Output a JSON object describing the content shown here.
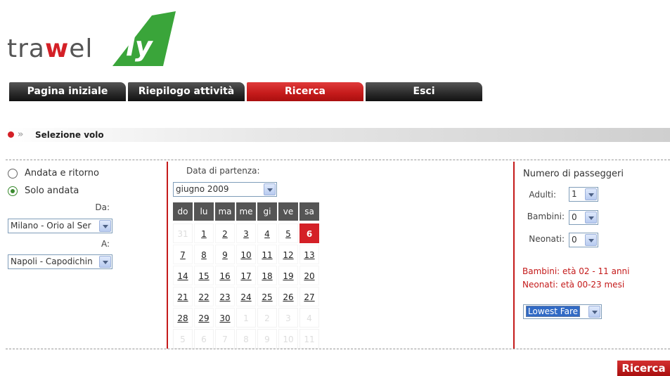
{
  "brand": {
    "part1": "tra",
    "part2": "w",
    "part3": "el",
    "fly": "fly",
    "accent": "#d42027",
    "logo_green": "#3aa53a"
  },
  "tabs": [
    {
      "label": "Pagina iniziale",
      "active": false
    },
    {
      "label": "Riepilogo attività",
      "active": false
    },
    {
      "label": "Ricerca",
      "active": true
    },
    {
      "label": "Esci",
      "active": false
    }
  ],
  "section": {
    "title": "Selezione volo"
  },
  "trip": {
    "options": [
      {
        "label": "Andata e ritorno",
        "checked": false
      },
      {
        "label": "Solo andata",
        "checked": true
      }
    ],
    "from_label": "Da:",
    "from_value": "Milano - Orio al Ser",
    "to_label": "A:",
    "to_value": "Napoli - Capodichin"
  },
  "calendar": {
    "label": "Data di partenza:",
    "month": "giugno 2009",
    "days": [
      "do",
      "lu",
      "ma",
      "me",
      "gi",
      "ve",
      "sa"
    ],
    "weeks": [
      [
        "31",
        "1",
        "2",
        "3",
        "4",
        "5",
        "6"
      ],
      [
        "7",
        "8",
        "9",
        "10",
        "11",
        "12",
        "13"
      ],
      [
        "14",
        "15",
        "16",
        "17",
        "18",
        "19",
        "20"
      ],
      [
        "21",
        "22",
        "23",
        "24",
        "25",
        "26",
        "27"
      ],
      [
        "28",
        "29",
        "30",
        "1",
        "2",
        "3",
        "4"
      ],
      [
        "5",
        "6",
        "7",
        "8",
        "9",
        "10",
        "11"
      ]
    ],
    "selected": "6"
  },
  "passengers": {
    "title": "Numero di passeggeri",
    "adults_label": "Adulti:",
    "adults_value": "1",
    "children_label": "Bambini:",
    "children_value": "0",
    "infants_label": "Neonati:",
    "infants_value": "0",
    "note_children": "Bambini: età 02 - 11 anni",
    "note_infants": "Neonati: età 00-23 mesi",
    "fare_value": "Lowest Fare"
  },
  "actions": {
    "search_label": "Ricerca"
  }
}
